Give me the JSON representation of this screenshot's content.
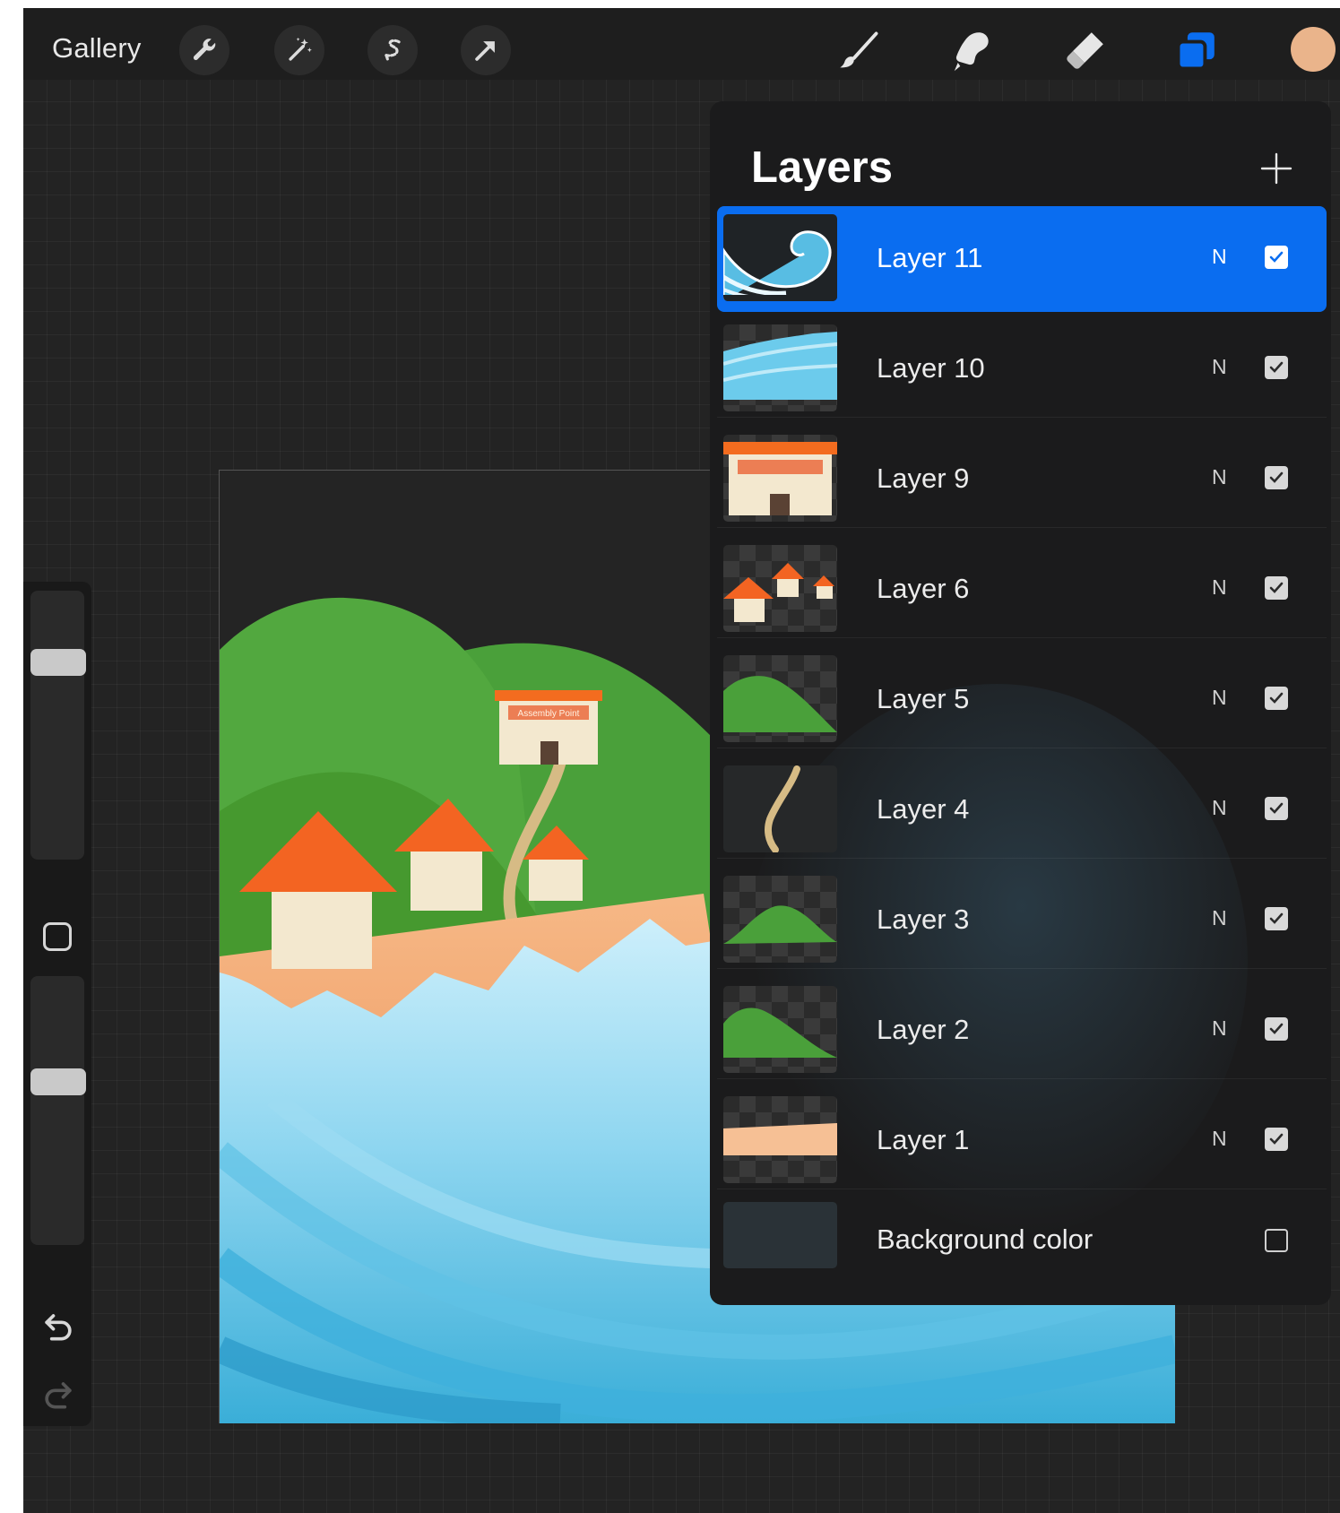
{
  "toolbar": {
    "gallery_label": "Gallery",
    "left_tools": [
      "wrench-icon",
      "magic-wand-icon",
      "selection-icon",
      "transform-arrow-icon"
    ],
    "right_tools": [
      "brush-icon",
      "smudge-icon",
      "eraser-icon",
      "layers-icon"
    ],
    "active_tool": "layers-icon",
    "current_color": "#eab48b",
    "accent_color": "#0a6df0"
  },
  "sidebar": {
    "controls": [
      "brush-size-slider",
      "modify-button",
      "opacity-slider",
      "undo-icon",
      "redo-icon"
    ],
    "brush_size": 0.76,
    "opacity": 0.62
  },
  "layers_panel": {
    "title": "Layers",
    "add_icon": "plus-icon",
    "layers": [
      {
        "name": "Layer 11",
        "blend": "N",
        "visible": true,
        "selected": true
      },
      {
        "name": "Layer 10",
        "blend": "N",
        "visible": true,
        "selected": false
      },
      {
        "name": "Layer 9",
        "blend": "N",
        "visible": true,
        "selected": false
      },
      {
        "name": "Layer 6",
        "blend": "N",
        "visible": true,
        "selected": false
      },
      {
        "name": "Layer 5",
        "blend": "N",
        "visible": true,
        "selected": false
      },
      {
        "name": "Layer 4",
        "blend": "N",
        "visible": true,
        "selected": false
      },
      {
        "name": "Layer 3",
        "blend": "N",
        "visible": true,
        "selected": false
      },
      {
        "name": "Layer 2",
        "blend": "N",
        "visible": true,
        "selected": false
      },
      {
        "name": "Layer 1",
        "blend": "N",
        "visible": true,
        "selected": false
      }
    ],
    "background": {
      "name": "Background color",
      "visible": false
    }
  },
  "canvas": {
    "sign_text": "Assembly Point"
  }
}
